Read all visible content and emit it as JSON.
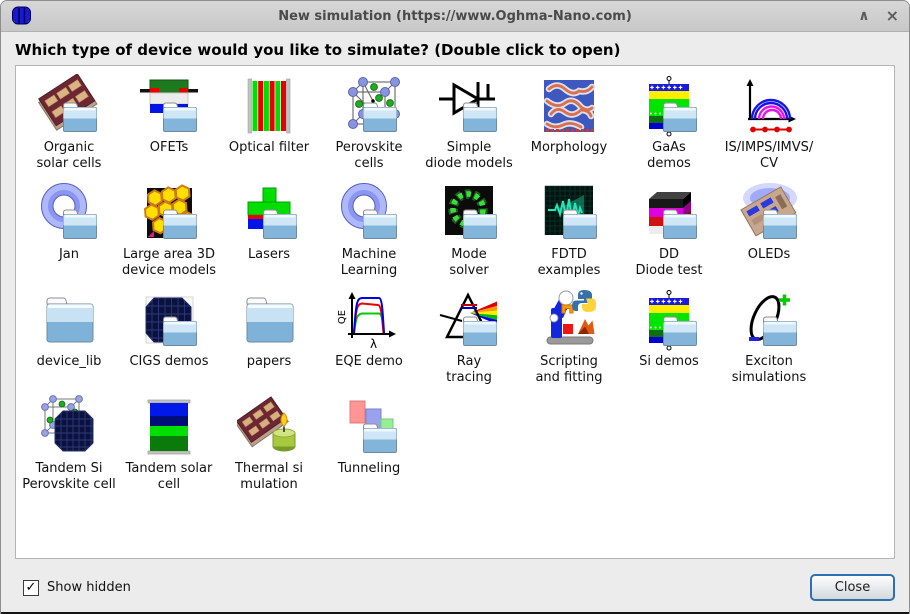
{
  "window": {
    "title": "New simulation (https://www.Oghma-Nano.com)",
    "controls": {
      "shade": "∧",
      "close": "×"
    }
  },
  "heading": "Which type of device would you like to simulate? (Double click to open)",
  "devices": [
    {
      "name": "organic-solar-cells",
      "label": "Organic solar cells",
      "label_lines": [
        "Organic",
        "solar cells"
      ],
      "icon": "organic-solar-cell",
      "has_folder": true
    },
    {
      "name": "ofets",
      "label": "OFETs",
      "label_lines": [
        "OFETs"
      ],
      "icon": "ofet-stack",
      "has_folder": true
    },
    {
      "name": "optical-filter",
      "label": "Optical filter",
      "label_lines": [
        "Optical filter"
      ],
      "icon": "optical-filter",
      "has_folder": false
    },
    {
      "name": "perovskite-cells",
      "label": "Perovskite cells",
      "label_lines": [
        "Perovskite",
        "cells"
      ],
      "icon": "perovskite-lattice",
      "has_folder": true
    },
    {
      "name": "simple-diode-models",
      "label": "Simple diode models",
      "label_lines": [
        "Simple",
        "diode models"
      ],
      "icon": "diode-symbol",
      "has_folder": true
    },
    {
      "name": "morphology",
      "label": "Morphology",
      "label_lines": [
        "Morphology"
      ],
      "icon": "morphology-pattern",
      "has_folder": false
    },
    {
      "name": "gaas-demos",
      "label": "GaAs demos",
      "label_lines": [
        "GaAs",
        "demos"
      ],
      "icon": "layer-stack",
      "has_folder": true
    },
    {
      "name": "is-imps-imvs-cv",
      "label": "IS/IMPS/IMVS/CV",
      "label_lines": [
        "IS/IMPS/IMVS/",
        "CV"
      ],
      "icon": "impedance-plot",
      "has_folder": false
    },
    {
      "name": "jan",
      "label": "Jan",
      "label_lines": [
        "Jan"
      ],
      "icon": "torus",
      "has_folder": true
    },
    {
      "name": "large-area-3d-device-models",
      "label": "Large area 3D device models",
      "label_lines": [
        "Large area 3D",
        "device models"
      ],
      "icon": "honeycomb-3d",
      "has_folder": true
    },
    {
      "name": "lasers",
      "label": "Lasers",
      "label_lines": [
        "Lasers"
      ],
      "icon": "laser-mesa",
      "has_folder": true
    },
    {
      "name": "machine-learning",
      "label": "Machine Learning",
      "label_lines": [
        "Machine",
        "Learning"
      ],
      "icon": "torus",
      "has_folder": true
    },
    {
      "name": "mode-solver",
      "label": "Mode solver",
      "label_lines": [
        "Mode",
        "solver"
      ],
      "icon": "mode-ring",
      "has_folder": true
    },
    {
      "name": "fdtd-examples",
      "label": "FDTD examples",
      "label_lines": [
        "FDTD",
        "examples"
      ],
      "icon": "fdtd-wave",
      "has_folder": true
    },
    {
      "name": "dd-diode-test",
      "label": "DD Diode test",
      "label_lines": [
        "DD",
        "Diode test"
      ],
      "icon": "dd-stack",
      "has_folder": true
    },
    {
      "name": "oleds",
      "label": "OLEDs",
      "label_lines": [
        "OLEDs"
      ],
      "icon": "oled-glow",
      "has_folder": true
    },
    {
      "name": "device_lib",
      "label": "device_lib",
      "label_lines": [
        "device_lib"
      ],
      "icon": "folder",
      "has_folder": false
    },
    {
      "name": "cigs-demos",
      "label": "CIGS demos",
      "label_lines": [
        "CIGS demos"
      ],
      "icon": "cigs-panel",
      "has_folder": true
    },
    {
      "name": "papers",
      "label": "papers",
      "label_lines": [
        "papers"
      ],
      "icon": "folder",
      "has_folder": false
    },
    {
      "name": "eqe-demo",
      "label": "EQE demo",
      "label_lines": [
        "EQE demo"
      ],
      "icon": "eqe-plot",
      "has_folder": false
    },
    {
      "name": "ray-tracing",
      "label": "Ray tracing",
      "label_lines": [
        "Ray",
        "tracing"
      ],
      "icon": "prism-rainbow",
      "has_folder": true
    },
    {
      "name": "scripting-and-fitting",
      "label": "Scripting and fitting",
      "label_lines": [
        "Scripting",
        "and fitting"
      ],
      "icon": "robot-scripting",
      "has_folder": false
    },
    {
      "name": "si-demos",
      "label": "Si demos",
      "label_lines": [
        "Si demos"
      ],
      "icon": "layer-stack",
      "has_folder": true
    },
    {
      "name": "exciton-simulations",
      "label": "Exciton simulations",
      "label_lines": [
        "Exciton",
        "simulations"
      ],
      "icon": "exciton-orbit",
      "has_folder": true
    },
    {
      "name": "tandem-si-perovskite-cell",
      "label": "Tandem Si Perovskite cell",
      "label_lines": [
        "Tandem Si",
        "Perovskite cell"
      ],
      "icon": "tandem-lattice-panel",
      "has_folder": false
    },
    {
      "name": "tandem-solar-cell",
      "label": "Tandem solar cell",
      "label_lines": [
        "Tandem solar",
        "cell"
      ],
      "icon": "tandem-stack",
      "has_folder": false
    },
    {
      "name": "thermal-simulation",
      "label": "Thermal si mulation",
      "label_lines": [
        "Thermal si",
        "mulation"
      ],
      "icon": "thermal-candle",
      "has_folder": false
    },
    {
      "name": "tunneling",
      "label": "Tunneling",
      "label_lines": [
        "Tunneling"
      ],
      "icon": "tunneling-blocks",
      "has_folder": true
    }
  ],
  "footer": {
    "show_hidden_label": "Show hidden",
    "show_hidden_checked": true,
    "check_glyph": "✓",
    "close_button": "Close"
  },
  "colors": {
    "titlebar": "#cdcdcd",
    "dialog_bg": "#ececec",
    "panel_bg": "#ffffff",
    "folder_blue": "#8fbcdf",
    "close_button_border": "#2e6fb0",
    "heading_text": "#000000",
    "title_text": "#4a4a4a"
  }
}
